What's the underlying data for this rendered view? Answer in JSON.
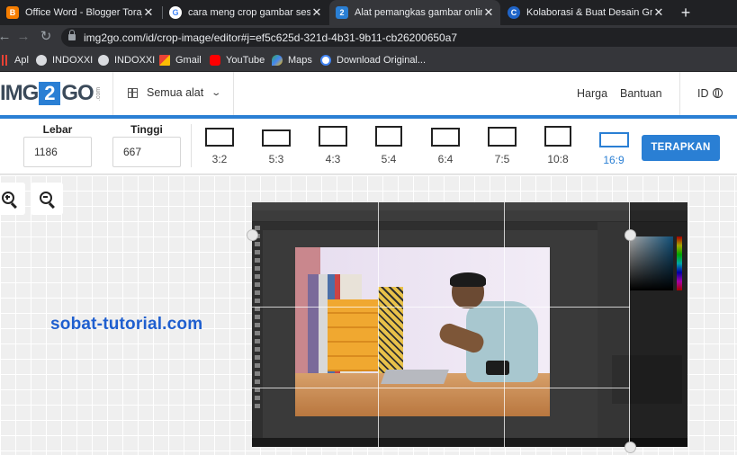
{
  "browser": {
    "tabs": [
      {
        "title": "Office Word - Blogger Toraja",
        "favicon_color": "#f57d00",
        "favicon_glyph": "B",
        "active": false
      },
      {
        "title": "cara meng crop gambar sesuai b",
        "favicon_color": "#ffffff",
        "favicon_glyph": "G",
        "active": false
      },
      {
        "title": "Alat pemangkas gambar online -",
        "favicon_color": "#2a7fd4",
        "favicon_glyph": "2",
        "active": true
      },
      {
        "title": "Kolaborasi & Buat Desain Grafis",
        "favicon_color": "#00c4cc",
        "favicon_glyph": "C",
        "active": false
      }
    ],
    "close_glyph": "✕",
    "new_tab_glyph": "+",
    "url": "img2go.com/id/crop-image/editor#j=ef5c625d-321d-4b31-9b11-cb26200650a7",
    "nav_icons": {
      "back": "←",
      "forward": "→",
      "reload": "↻"
    }
  },
  "bookmarks": [
    {
      "label": "Apl",
      "icon": "apps-grid-icon",
      "color": "#e94235"
    },
    {
      "label": "INDOXXI",
      "icon": "globe-icon",
      "color": "#dadce0"
    },
    {
      "label": "INDOXXI",
      "icon": "globe-icon",
      "color": "#dadce0"
    },
    {
      "label": "Gmail",
      "icon": "gmail-icon",
      "color": "#ea4335"
    },
    {
      "label": "YouTube",
      "icon": "youtube-icon",
      "color": "#ff0000"
    },
    {
      "label": "Maps",
      "icon": "maps-icon",
      "color": "#34a853"
    },
    {
      "label": "Download Original...",
      "icon": "google-icon",
      "color": "#ffffff"
    }
  ],
  "site": {
    "logo": {
      "left": "IMG",
      "mid": "2",
      "right": "GO",
      "tld": ".com"
    },
    "all_tools": "Semua alat",
    "nav": {
      "pricing": "Harga",
      "help": "Bantuan",
      "lang": "ID"
    },
    "accent": "#2a7fd4"
  },
  "crop_toolbar": {
    "width_label": "Lebar",
    "width_value": "1186",
    "height_label": "Tinggi",
    "height_value": "667",
    "ratios": [
      {
        "label": "3:2",
        "selected": false
      },
      {
        "label": "5:3",
        "selected": false
      },
      {
        "label": "4:3",
        "selected": false
      },
      {
        "label": "5:4",
        "selected": false
      },
      {
        "label": "6:4",
        "selected": false
      },
      {
        "label": "7:5",
        "selected": false
      },
      {
        "label": "10:8",
        "selected": false
      },
      {
        "label": "16:9",
        "selected": true
      }
    ],
    "apply_label": "TERAPKAN"
  },
  "workspace": {
    "zoom_in_icon": "zoom-in-icon",
    "zoom_out_icon": "zoom-out-icon",
    "watermark": "sobat-tutorial.com"
  }
}
